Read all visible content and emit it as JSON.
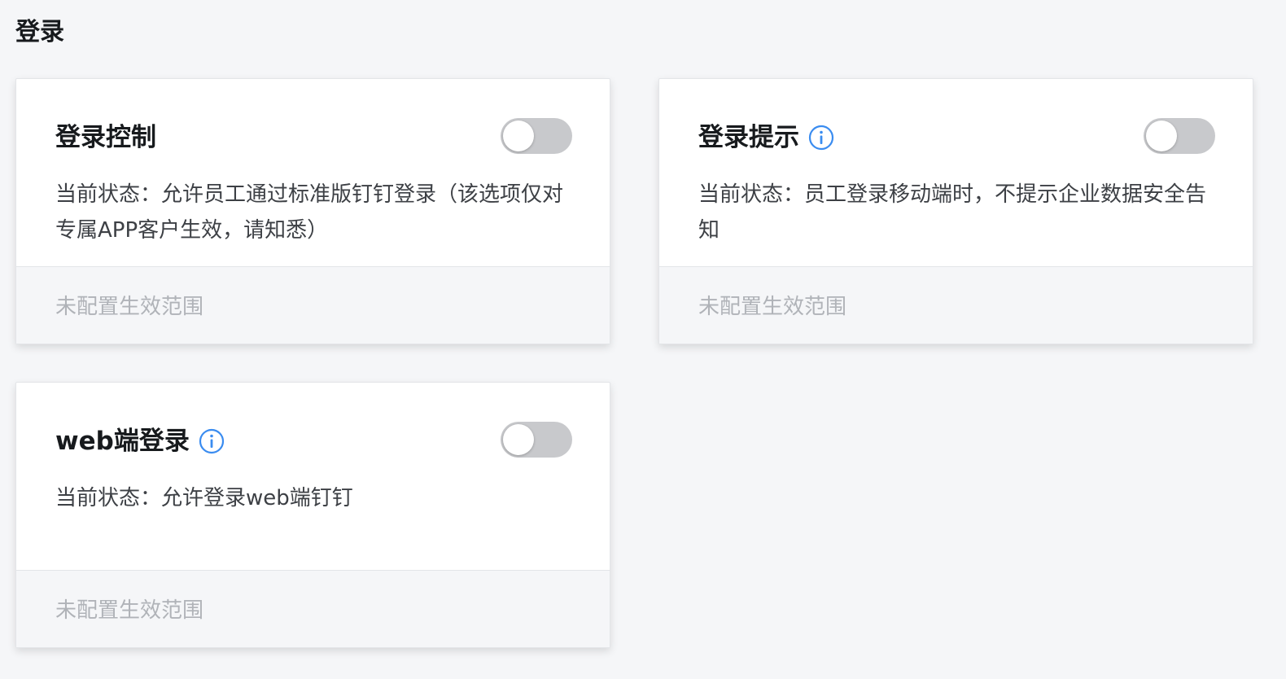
{
  "section": {
    "title": "登录"
  },
  "cards": [
    {
      "title": "登录控制",
      "has_info_icon": false,
      "toggle_on": false,
      "description": "当前状态：允许员工通过标准版钉钉登录（该选项仅对专属APP客户生效，请知悉）",
      "footer": "未配置生效范围"
    },
    {
      "title": "登录提示",
      "has_info_icon": true,
      "toggle_on": false,
      "description": "当前状态：员工登录移动端时，不提示企业数据安全告知",
      "footer": "未配置生效范围"
    },
    {
      "title": "web端登录",
      "has_info_icon": true,
      "toggle_on": false,
      "description": "当前状态：允许登录web端钉钉",
      "footer": "未配置生效范围"
    }
  ],
  "icons": {
    "info": "info-circle-icon"
  },
  "colors": {
    "page_background": "#f5f6f8",
    "card_background": "#ffffff",
    "footer_background": "#f5f6f8",
    "toggle_off": "#c8c9cc",
    "info_icon": "#3a8cf0",
    "footer_text": "#b0b3b8"
  }
}
